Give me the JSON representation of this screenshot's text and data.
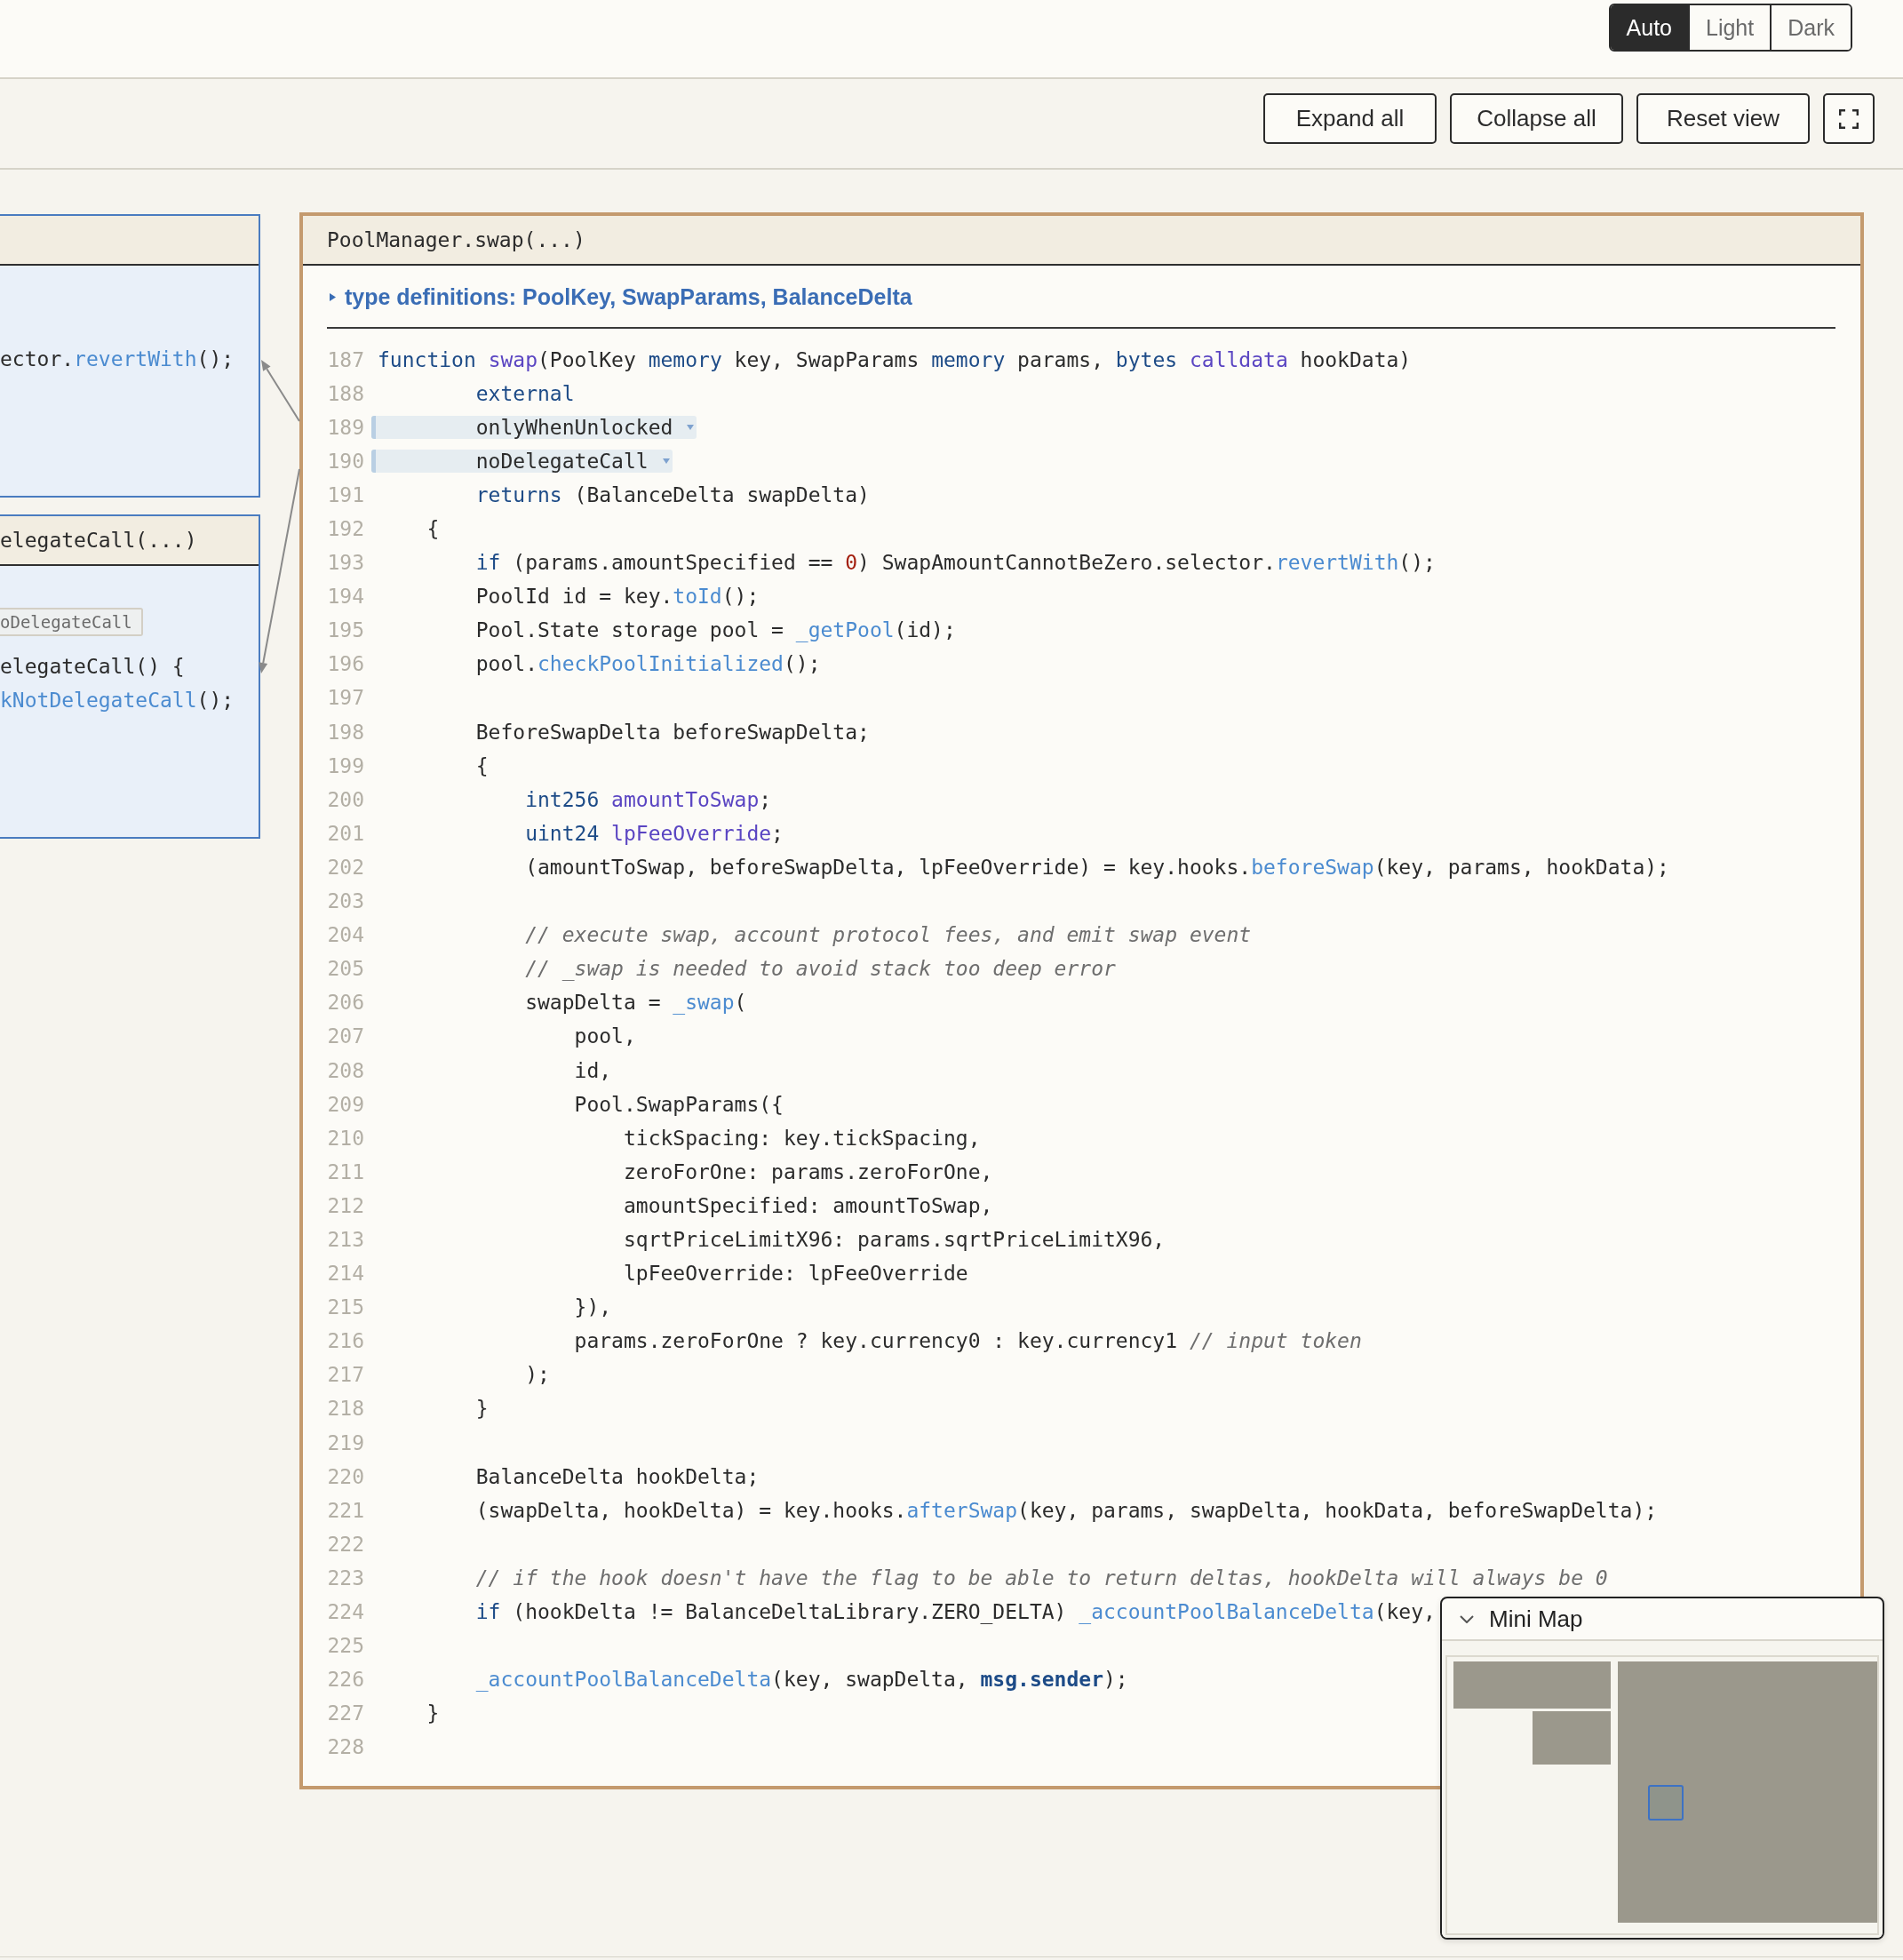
{
  "theme_toggle": {
    "options": [
      {
        "label": "Auto",
        "selected": true
      },
      {
        "label": "Light",
        "selected": false
      },
      {
        "label": "Dark",
        "selected": false
      }
    ]
  },
  "toolbar": {
    "buttons": [
      "Expand all",
      "Collapse all",
      "Reset view"
    ]
  },
  "canvas": {
    "side_panels": [
      {
        "lines": [
          {
            "tokens": [
              {
                "kind": "plain",
                "text": "ector."
              },
              {
                "kind": "call",
                "text": "revertWith"
              },
              {
                "kind": "plain",
                "text": "();"
              }
            ]
          }
        ]
      },
      {
        "title": "elegateCall(...)",
        "tag": "oDelegateCall",
        "lines": [
          {
            "tokens": [
              {
                "kind": "plain",
                "text": "elegateCall() {"
              }
            ]
          },
          {
            "tokens": [
              {
                "kind": "call",
                "text": "kNotDelegateCall"
              },
              {
                "kind": "plain",
                "text": "();"
              }
            ]
          }
        ]
      }
    ],
    "main_panel": {
      "title": "PoolManager.swap(...)",
      "type_definitions": {
        "label": "type definitions: PoolKey, SwapParams, BalanceDelta",
        "expanded": false
      },
      "lines": [
        {
          "number": "187",
          "kind": "code",
          "tokens": [
            {
              "kind": "keyword",
              "text": "function "
            },
            {
              "kind": "name",
              "text": "swap"
            },
            {
              "kind": "plain",
              "text": "(PoolKey "
            },
            {
              "kind": "keyword",
              "text": "memory"
            },
            {
              "kind": "plain",
              "text": " key, SwapParams "
            },
            {
              "kind": "keyword",
              "text": "memory"
            },
            {
              "kind": "plain",
              "text": " params, "
            },
            {
              "kind": "keyword",
              "text": "bytes "
            },
            {
              "kind": "name",
              "text": "calldata"
            },
            {
              "kind": "plain",
              "text": " hookData)"
            }
          ]
        },
        {
          "number": "188",
          "kind": "code",
          "tokens": [
            {
              "kind": "keyword",
              "text": "        external"
            }
          ]
        },
        {
          "number": "189",
          "kind": "modifier",
          "tokens": [
            {
              "kind": "plain",
              "text": "        onlyWhenUnlocked"
            }
          ]
        },
        {
          "number": "190",
          "kind": "modifier",
          "tokens": [
            {
              "kind": "plain",
              "text": "        noDelegateCall"
            }
          ]
        },
        {
          "number": "191",
          "kind": "code",
          "tokens": [
            {
              "kind": "keyword",
              "text": "        returns"
            },
            {
              "kind": "plain",
              "text": " (BalanceDelta swapDelta)"
            }
          ]
        },
        {
          "number": "192",
          "kind": "code",
          "tokens": [
            {
              "kind": "plain",
              "text": "    {"
            }
          ]
        },
        {
          "number": "193",
          "kind": "code",
          "tokens": [
            {
              "kind": "keyword",
              "text": "        if"
            },
            {
              "kind": "plain",
              "text": " (params.amountSpecified == "
            },
            {
              "kind": "number",
              "text": "0"
            },
            {
              "kind": "plain",
              "text": ") SwapAmountCannotBeZero.selector."
            },
            {
              "kind": "call",
              "text": "revertWith"
            },
            {
              "kind": "plain",
              "text": "();"
            }
          ]
        },
        {
          "number": "194",
          "kind": "code",
          "tokens": [
            {
              "kind": "plain",
              "text": "        PoolId id = key."
            },
            {
              "kind": "call",
              "text": "toId"
            },
            {
              "kind": "plain",
              "text": "();"
            }
          ]
        },
        {
          "number": "195",
          "kind": "code",
          "tokens": [
            {
              "kind": "plain",
              "text": "        Pool.State storage pool = "
            },
            {
              "kind": "call",
              "text": "_getPool"
            },
            {
              "kind": "plain",
              "text": "(id);"
            }
          ]
        },
        {
          "number": "196",
          "kind": "code",
          "tokens": [
            {
              "kind": "plain",
              "text": "        pool."
            },
            {
              "kind": "call",
              "text": "checkPoolInitialized"
            },
            {
              "kind": "plain",
              "text": "();"
            }
          ]
        },
        {
          "number": "197",
          "kind": "code"
        },
        {
          "number": "198",
          "kind": "code",
          "tokens": [
            {
              "kind": "plain",
              "text": "        BeforeSwapDelta beforeSwapDelta;"
            }
          ]
        },
        {
          "number": "199",
          "kind": "code",
          "tokens": [
            {
              "kind": "plain",
              "text": "        {"
            }
          ]
        },
        {
          "number": "200",
          "kind": "code",
          "tokens": [
            {
              "kind": "keyword",
              "text": "            int256 "
            },
            {
              "kind": "name",
              "text": "amountToSwap"
            },
            {
              "kind": "plain",
              "text": ";"
            }
          ]
        },
        {
          "number": "201",
          "kind": "code",
          "tokens": [
            {
              "kind": "keyword",
              "text": "            uint24 "
            },
            {
              "kind": "name",
              "text": "lpFeeOverride"
            },
            {
              "kind": "plain",
              "text": ";"
            }
          ]
        },
        {
          "number": "202",
          "kind": "code",
          "tokens": [
            {
              "kind": "plain",
              "text": "            (amountToSwap, beforeSwapDelta, lpFeeOverride) = key.hooks."
            },
            {
              "kind": "call",
              "text": "beforeSwap"
            },
            {
              "kind": "plain",
              "text": "(key, params, hookData);"
            }
          ]
        },
        {
          "number": "203",
          "kind": "code"
        },
        {
          "number": "204",
          "kind": "code",
          "tokens": [
            {
              "kind": "comment",
              "text": "            // execute swap, account protocol fees, and emit swap event"
            }
          ]
        },
        {
          "number": "205",
          "kind": "code",
          "tokens": [
            {
              "kind": "comment",
              "text": "            // _swap is needed to avoid stack too deep error"
            }
          ]
        },
        {
          "number": "206",
          "kind": "code",
          "tokens": [
            {
              "kind": "plain",
              "text": "            swapDelta = "
            },
            {
              "kind": "call",
              "text": "_swap"
            },
            {
              "kind": "plain",
              "text": "("
            }
          ]
        },
        {
          "number": "207",
          "kind": "code",
          "tokens": [
            {
              "kind": "plain",
              "text": "                pool,"
            }
          ]
        },
        {
          "number": "208",
          "kind": "code",
          "tokens": [
            {
              "kind": "plain",
              "text": "                id,"
            }
          ]
        },
        {
          "number": "209",
          "kind": "code",
          "tokens": [
            {
              "kind": "plain",
              "text": "                Pool.SwapParams({"
            }
          ]
        },
        {
          "number": "210",
          "kind": "code",
          "tokens": [
            {
              "kind": "plain",
              "text": "                    tickSpacing: key.tickSpacing,"
            }
          ]
        },
        {
          "number": "211",
          "kind": "code",
          "tokens": [
            {
              "kind": "plain",
              "text": "                    zeroForOne: params.zeroForOne,"
            }
          ]
        },
        {
          "number": "212",
          "kind": "code",
          "tokens": [
            {
              "kind": "plain",
              "text": "                    amountSpecified: amountToSwap,"
            }
          ]
        },
        {
          "number": "213",
          "kind": "code",
          "tokens": [
            {
              "kind": "plain",
              "text": "                    sqrtPriceLimitX96: params.sqrtPriceLimitX96,"
            }
          ]
        },
        {
          "number": "214",
          "kind": "code",
          "tokens": [
            {
              "kind": "plain",
              "text": "                    lpFeeOverride: lpFeeOverride"
            }
          ]
        },
        {
          "number": "215",
          "kind": "code",
          "tokens": [
            {
              "kind": "plain",
              "text": "                }),"
            }
          ]
        },
        {
          "number": "216",
          "kind": "code",
          "tokens": [
            {
              "kind": "plain",
              "text": "                params.zeroForOne ? key.currency0 : key.currency1 "
            },
            {
              "kind": "comment",
              "text": "// input token"
            }
          ]
        },
        {
          "number": "217",
          "kind": "code",
          "tokens": [
            {
              "kind": "plain",
              "text": "            );"
            }
          ]
        },
        {
          "number": "218",
          "kind": "code",
          "tokens": [
            {
              "kind": "plain",
              "text": "        }"
            }
          ]
        },
        {
          "number": "219",
          "kind": "code"
        },
        {
          "number": "220",
          "kind": "code",
          "tokens": [
            {
              "kind": "plain",
              "text": "        BalanceDelta hookDelta;"
            }
          ]
        },
        {
          "number": "221",
          "kind": "code",
          "tokens": [
            {
              "kind": "plain",
              "text": "        (swapDelta, hookDelta) = key.hooks."
            },
            {
              "kind": "call",
              "text": "afterSwap"
            },
            {
              "kind": "plain",
              "text": "(key, params, swapDelta, hookData, beforeSwapDelta);"
            }
          ]
        },
        {
          "number": "222",
          "kind": "code"
        },
        {
          "number": "223",
          "kind": "code",
          "tokens": [
            {
              "kind": "comment",
              "text": "        // if the hook doesn't have the flag to be able to return deltas, hookDelta will always be 0"
            }
          ]
        },
        {
          "number": "224",
          "kind": "code",
          "tokens": [
            {
              "kind": "keyword",
              "text": "        if"
            },
            {
              "kind": "plain",
              "text": " (hookDelta != BalanceDeltaLibrary.ZERO_DELTA) "
            },
            {
              "kind": "call",
              "text": "_accountPoolBalanceDelta"
            },
            {
              "kind": "plain",
              "text": "(key,"
            }
          ]
        },
        {
          "number": "225",
          "kind": "code"
        },
        {
          "number": "226",
          "kind": "code",
          "tokens": [
            {
              "kind": "call",
              "text": "        _accountPoolBalanceDelta"
            },
            {
              "kind": "plain",
              "text": "(key, swapDelta, "
            },
            {
              "kind": "builtin",
              "text": "msg.sender"
            },
            {
              "kind": "plain",
              "text": ");"
            }
          ]
        },
        {
          "number": "227",
          "kind": "code",
          "tokens": [
            {
              "kind": "plain",
              "text": "    }"
            }
          ]
        },
        {
          "number": "228",
          "kind": "code"
        }
      ]
    }
  },
  "mini_map": {
    "title": "Mini Map",
    "expanded": true
  }
}
